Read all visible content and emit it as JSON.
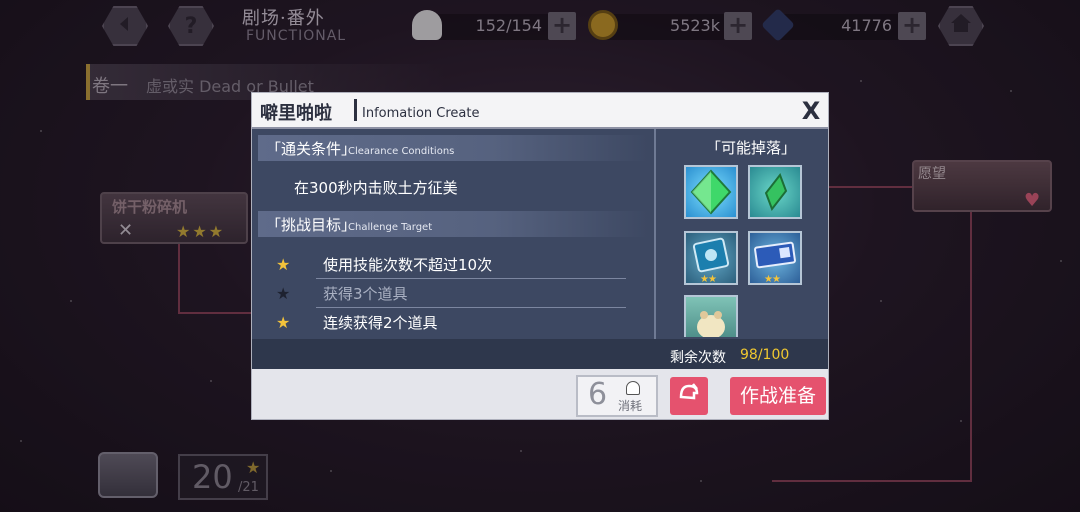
{
  "topbar": {
    "back_icon": "chevron-left-icon",
    "help_label": "?",
    "title_cn": "剧场·番外",
    "title_en": "FUNCTIONAL",
    "stamina_value": "152/154",
    "coin_value": "5523k",
    "crystal_value": "41776",
    "plus_label": "+",
    "home_icon": "house-icon"
  },
  "stage": {
    "chapter_label": "卷一",
    "chapter_name": "虚或实 Dead or Bullet",
    "node_title": "饼干粉碎机",
    "node_stars": "★★★",
    "right_node_title": "愿望",
    "chest_count_big": "20",
    "chest_count_small": "/21",
    "chest_star": "★"
  },
  "modal": {
    "title_cn": "噼里啪啦",
    "title_en": "Infomation Create",
    "close_label": "X",
    "clearance": {
      "label_cn": "「通关条件」",
      "label_en": "Clearance Conditions",
      "text": "在300秒内击败土方征美"
    },
    "challenge": {
      "label_cn": "「挑战目标」",
      "label_en": "Challenge Target",
      "goals": [
        {
          "star": "★",
          "text": "使用技能次数不超过10次",
          "achieved": true
        },
        {
          "star": "★",
          "text": "获得3个道具",
          "achieved": false
        },
        {
          "star": "★",
          "text": "连续获得2个道具",
          "achieved": true
        }
      ]
    },
    "drops": {
      "title": "「可能掉落」",
      "items": [
        {
          "name": "green-crystal-large",
          "stars": ""
        },
        {
          "name": "green-crystal-small",
          "stars": ""
        },
        {
          "name": "blue-book",
          "stars": "★★"
        },
        {
          "name": "blue-ticket",
          "stars": "★★"
        },
        {
          "name": "hamster-figure",
          "stars": ""
        }
      ]
    },
    "remaining_label": "剩余次数",
    "remaining_value": "98/100",
    "cost_value": "6",
    "cost_label": "消耗",
    "auto_icon": "auto-battle-icon",
    "battle_label": "作战准备"
  },
  "colors": {
    "accent_pink": "#e5526e",
    "panel_blue": "#3d4862",
    "star_gold": "#f3c33b",
    "star_dim": "#1e2230",
    "remaining_gold": "#f0c830"
  }
}
